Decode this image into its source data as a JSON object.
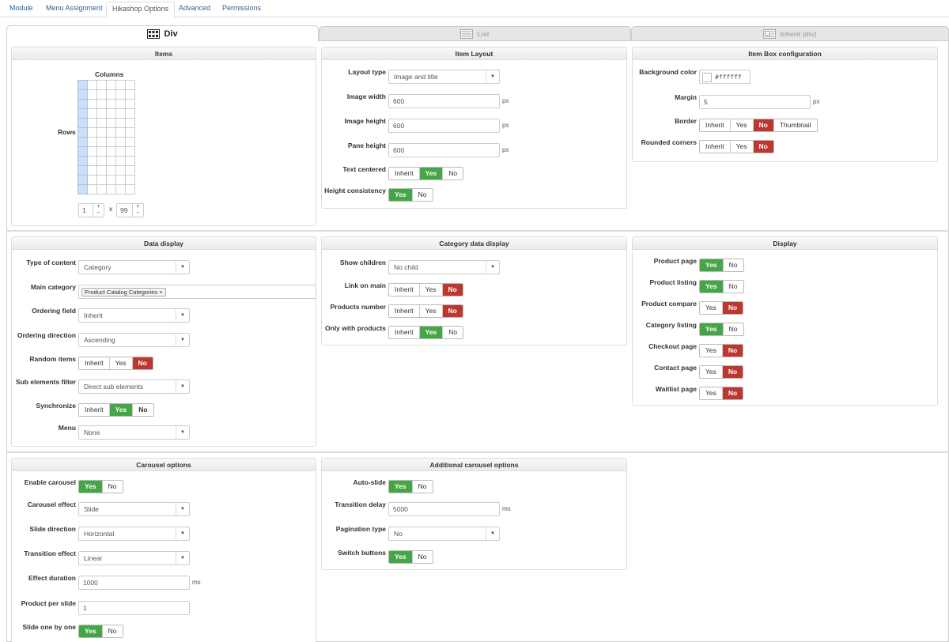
{
  "top_tabs": [
    {
      "label": "Module"
    },
    {
      "label": "Menu Assignment"
    },
    {
      "label": "Hikashop Options"
    },
    {
      "label": "Advanced"
    },
    {
      "label": "Permissions"
    }
  ],
  "layout_tabs": {
    "div": "Div",
    "list": "List",
    "inherit": "Inherit (div)"
  },
  "items": {
    "title": "Items",
    "columns_label": "Columns",
    "rows_label": "Rows",
    "columns_value": "1",
    "times": "x",
    "rows_value": "99",
    "plus": "+",
    "minus": "−"
  },
  "item_layout": {
    "title": "Item Layout",
    "layout_type": {
      "label": "Layout type",
      "value": "Image and title"
    },
    "image_width": {
      "label": "Image width",
      "value": "600",
      "unit": "px"
    },
    "image_height": {
      "label": "Image height",
      "value": "600",
      "unit": "px"
    },
    "pane_height": {
      "label": "Pane height",
      "value": "600",
      "unit": "px"
    },
    "text_centered": {
      "label": "Text centered",
      "o1": "Inherit",
      "o2": "Yes",
      "o3": "No"
    },
    "height_consistency": {
      "label": "Height consistency",
      "o1": "Yes",
      "o2": "No"
    }
  },
  "item_box": {
    "title": "Item Box configuration",
    "bg_color": {
      "label": "Background color",
      "value": "#ffffff"
    },
    "margin": {
      "label": "Margin",
      "value": "5",
      "unit": "px"
    },
    "border": {
      "label": "Border",
      "o1": "Inherit",
      "o2": "Yes",
      "o3": "No",
      "o4": "Thumbnail"
    },
    "rounded": {
      "label": "Rounded corners",
      "o1": "Inherit",
      "o2": "Yes",
      "o3": "No"
    }
  },
  "data_display": {
    "title": "Data display",
    "type_of_content": {
      "label": "Type of content",
      "value": "Category"
    },
    "main_category": {
      "label": "Main category",
      "chip": "Product Catalog Categories",
      "chip_x": "×"
    },
    "ordering_field": {
      "label": "Ordering field",
      "value": "Inherit"
    },
    "ordering_direction": {
      "label": "Ordering direction",
      "value": "Ascending"
    },
    "random_items": {
      "label": "Random items",
      "o1": "Inherit",
      "o2": "Yes",
      "o3": "No"
    },
    "sub_filter": {
      "label": "Sub elements filter",
      "value": "Direct sub elements"
    },
    "synchronize": {
      "label": "Synchronize",
      "o1": "Inherit",
      "o2": "Yes",
      "o3": "No"
    },
    "menu": {
      "label": "Menu",
      "value": "None"
    }
  },
  "category_data": {
    "title": "Category data display",
    "show_children": {
      "label": "Show children",
      "value": "No child"
    },
    "link_on_main": {
      "label": "Link on main",
      "o1": "Inherit",
      "o2": "Yes",
      "o3": "No"
    },
    "products_number": {
      "label": "Products number",
      "o1": "Inherit",
      "o2": "Yes",
      "o3": "No"
    },
    "only_with_products": {
      "label": "Only with products",
      "o1": "Inherit",
      "o2": "Yes",
      "o3": "No"
    }
  },
  "display": {
    "title": "Display",
    "yes": "Yes",
    "no": "No",
    "product_page": "Product page",
    "product_listing": "Product listing",
    "product_compare": "Product compare",
    "category_listing": "Category listing",
    "checkout_page": "Checkout page",
    "contact_page": "Contact page",
    "waitlist_page": "Waitlist page"
  },
  "carousel": {
    "title": "Carousel options",
    "yes": "Yes",
    "no": "No",
    "enable": "Enable carousel",
    "effect": {
      "label": "Carousel effect",
      "value": "Slide"
    },
    "direction": {
      "label": "Slide direction",
      "value": "Horizontal"
    },
    "transition": {
      "label": "Transition effect",
      "value": "Linear"
    },
    "duration": {
      "label": "Effect duration",
      "value": "1000",
      "unit": "ms"
    },
    "per_slide": {
      "label": "Product per slide",
      "value": "1"
    },
    "one_by_one": "Slide one by one"
  },
  "additional": {
    "title": "Additional carousel options",
    "yes": "Yes",
    "no": "No",
    "auto_slide": "Auto-slide",
    "delay": {
      "label": "Transition delay",
      "value": "5000",
      "unit": "ms"
    },
    "pagination": {
      "label": "Pagination type",
      "value": "No"
    },
    "switch_buttons": "Switch buttons"
  },
  "colors": {
    "active_green": "#46a546",
    "active_red": "#bd362f",
    "link_blue": "#2a6496"
  }
}
